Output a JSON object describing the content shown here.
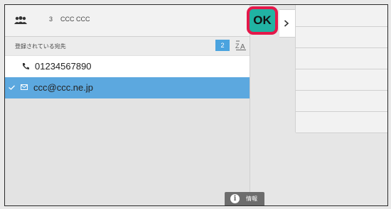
{
  "header": {
    "group_icon": "group-icon",
    "count": "3",
    "name": "CCC CCC"
  },
  "subheader": {
    "label": "登録されている宛先",
    "count": "2",
    "sort_icon": "sort-icon"
  },
  "destinations": [
    {
      "type": "phone",
      "icon": "phone-icon",
      "value": "01234567890",
      "selected": false
    },
    {
      "type": "email",
      "icon": "mail-icon",
      "value": "ccc@ccc.ne.jp",
      "selected": true
    }
  ],
  "ok_button": {
    "label": "OK"
  },
  "info_button": {
    "icon": "info-icon",
    "label": "情報"
  },
  "colors": {
    "selected_row": "#5ca8df",
    "ok_button": "#21b3a3",
    "ok_highlight": "#e4184a",
    "badge": "#4aa3df"
  }
}
